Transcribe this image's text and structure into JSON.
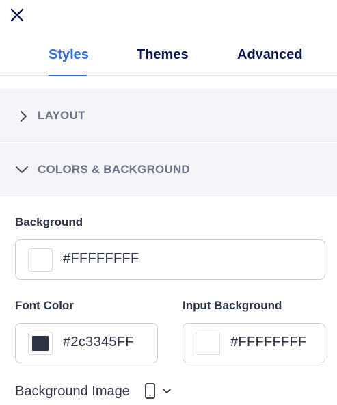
{
  "close": {
    "icon": "close-icon"
  },
  "tabs": [
    {
      "label": "Styles",
      "active": true
    },
    {
      "label": "Themes",
      "active": false
    },
    {
      "label": "Advanced",
      "active": false
    }
  ],
  "sections": {
    "layout": {
      "label": "LAYOUT",
      "expanded": false
    },
    "colors": {
      "label": "COLORS & BACKGROUND",
      "expanded": true
    }
  },
  "fields": {
    "background": {
      "label": "Background",
      "value": "#FFFFFFFF",
      "swatch_color": "#FFFFFF"
    },
    "font_color": {
      "label": "Font Color",
      "value": "#2c3345FF",
      "swatch_color": "#2c3345"
    },
    "input_background": {
      "label": "Input Background",
      "value": "#FFFFFFFF",
      "swatch_color": "#FFFFFF"
    },
    "background_image": {
      "label": "Background Image",
      "device_icon": "mobile-device-icon"
    }
  },
  "colors": {
    "accent": "#2e6fd6",
    "text": "#2c3345",
    "muted": "#6c7387",
    "section_bg": "#f3f5f8"
  }
}
